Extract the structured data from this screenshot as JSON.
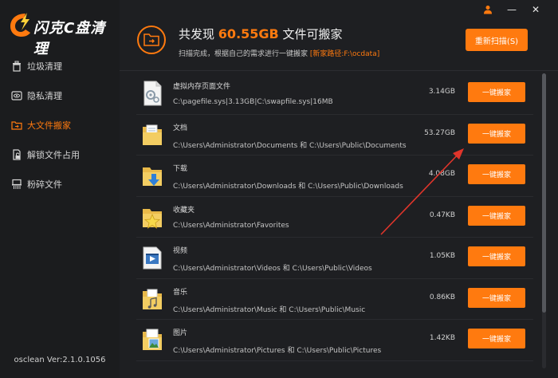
{
  "app": {
    "logo_text": "闪克C盘清理",
    "version": "osclean Ver:2.1.0.1056"
  },
  "window": {
    "user_icon": "user-icon",
    "minimize": "—",
    "close": "✕"
  },
  "sidebar": {
    "items": [
      {
        "label": "垃圾清理",
        "icon": "trash-icon",
        "active": false
      },
      {
        "label": "隐私清理",
        "icon": "eye-icon",
        "active": false
      },
      {
        "label": "大文件搬家",
        "icon": "folder-move-icon",
        "active": true
      },
      {
        "label": "解锁文件占用",
        "icon": "unlock-icon",
        "active": false
      },
      {
        "label": "粉碎文件",
        "icon": "shred-icon",
        "active": false
      }
    ]
  },
  "header": {
    "title_prefix": "共发现",
    "title_size": "60.55GB",
    "title_suffix": "文件可搬家",
    "subtitle": "扫描完成，根据自己的需求进行一键搬家",
    "subtitle_path": "[新家路径:F:\\ocdata]",
    "rescan_label": "重新扫描(S)"
  },
  "files": [
    {
      "name": "虚拟内存页面文件",
      "path": "C:\\pagefile.sys|3.13GB|C:\\swapfile.sys|16MB",
      "size": "3.14GB",
      "button": "一键搬家",
      "icon": "system-file-icon"
    },
    {
      "name": "文档",
      "path": "C:\\Users\\Administrator\\Documents 和 C:\\Users\\Public\\Documents",
      "size": "53.27GB",
      "button": "一键搬家",
      "icon": "documents-folder-icon"
    },
    {
      "name": "下载",
      "path": "C:\\Users\\Administrator\\Downloads 和 C:\\Users\\Public\\Downloads",
      "size": "4.08GB",
      "button": "一键搬家",
      "icon": "downloads-folder-icon"
    },
    {
      "name": "收藏夹",
      "path": "C:\\Users\\Administrator\\Favorites",
      "size": "0.47KB",
      "button": "一键搬家",
      "icon": "favorites-folder-icon"
    },
    {
      "name": "视频",
      "path": "C:\\Users\\Administrator\\Videos 和 C:\\Users\\Public\\Videos",
      "size": "1.05KB",
      "button": "一键搬家",
      "icon": "videos-folder-icon"
    },
    {
      "name": "音乐",
      "path": "C:\\Users\\Administrator\\Music 和 C:\\Users\\Public\\Music",
      "size": "0.86KB",
      "button": "一键搬家",
      "icon": "music-folder-icon"
    },
    {
      "name": "图片",
      "path": "C:\\Users\\Administrator\\Pictures 和 C:\\Users\\Public\\Pictures",
      "size": "1.42KB",
      "button": "一键搬家",
      "icon": "pictures-folder-icon"
    }
  ],
  "colors": {
    "accent": "#ff7a0f",
    "background": "#1e1f22",
    "sidebar": "#1b1c1e",
    "annotation": "#e0352b"
  }
}
